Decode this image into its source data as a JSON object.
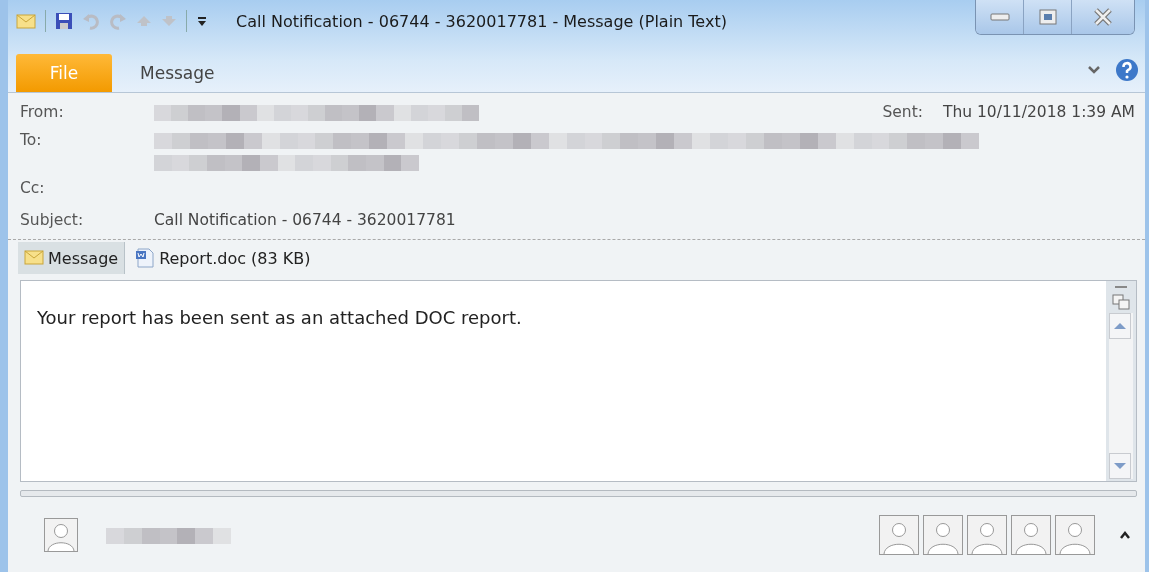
{
  "window": {
    "title": "Call Notification - 06744 - 3620017781 - Message (Plain Text)"
  },
  "ribbon_tabs": [
    {
      "label": "File",
      "kind": "file"
    },
    {
      "label": "Message",
      "kind": "tab"
    }
  ],
  "header": {
    "fields": [
      {
        "label": "From:",
        "kind": "blurred"
      },
      {
        "label": "To:",
        "kind": "blurred"
      },
      {
        "label": "Cc:",
        "kind": "empty"
      },
      {
        "label": "Subject:",
        "kind": "text",
        "value": "Call Notification - 06744 - 3620017781"
      }
    ],
    "sent": {
      "label": "Sent:",
      "value": "Thu 10/11/2018 1:39 AM"
    }
  },
  "attachments": [
    {
      "label": "Message",
      "kind": "message",
      "selected": true
    },
    {
      "label": "Report.doc (83 KB)",
      "kind": "doc",
      "selected": false
    }
  ],
  "body": {
    "text": "Your report has been sent as an attached DOC report."
  }
}
